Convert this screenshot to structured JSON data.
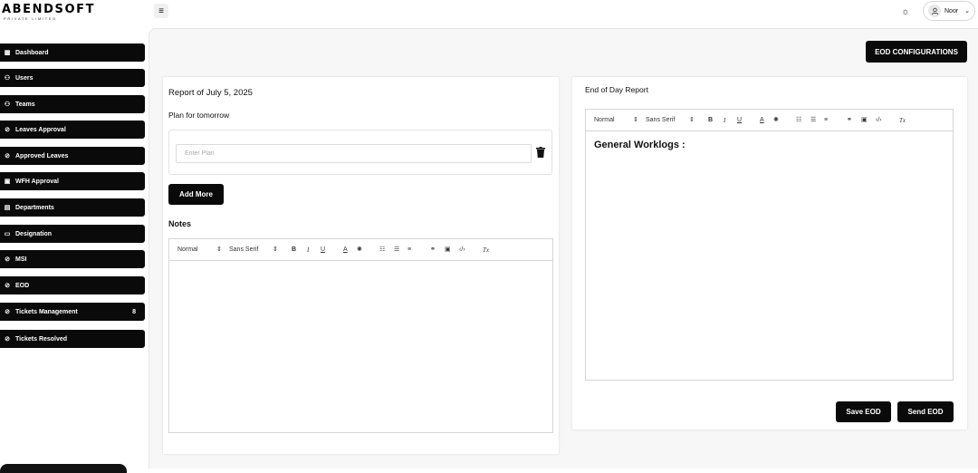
{
  "brand": {
    "name": "ABENDSOFT",
    "tagline": "PRIVATE LIMITED"
  },
  "header": {
    "menu_icon": "hamburger-icon",
    "theme_icon": "sun-icon",
    "user_name": "Noor"
  },
  "sidebar": {
    "items": [
      {
        "label": "Dashboard",
        "icon": "grid-icon"
      },
      {
        "label": "Users",
        "icon": "users-icon"
      },
      {
        "label": "Teams",
        "icon": "team-icon"
      },
      {
        "label": "Leaves Approval",
        "icon": "check-circle-icon"
      },
      {
        "label": "Approved Leaves",
        "icon": "check-circle-icon"
      },
      {
        "label": "WFH Approval",
        "icon": "doc-icon"
      },
      {
        "label": "Departments",
        "icon": "building-icon"
      },
      {
        "label": "Designation",
        "icon": "briefcase-icon"
      },
      {
        "label": "MSI",
        "icon": "check-circle-icon"
      },
      {
        "label": "EOD",
        "icon": "check-circle-icon"
      },
      {
        "label": "Tickets Management",
        "icon": "check-circle-icon",
        "badge": "8"
      },
      {
        "label": "Tickets Resolved",
        "icon": "check-circle-icon"
      }
    ]
  },
  "actions": {
    "eod_config": "EOD CONFIGURATIONS"
  },
  "report": {
    "title": "Report of July 5, 2025",
    "plan_label": "Plan for tomorrow",
    "plan_placeholder": "Enter Plan",
    "add_more": "Add More",
    "notes_label": "Notes"
  },
  "editor_toolbar": {
    "heading": "Normal",
    "font": "Sans Serif",
    "bold": "B",
    "italic": "I",
    "underline": "U",
    "color": "A",
    "clear": "Tx"
  },
  "eod": {
    "title": "End of Day Report",
    "content_heading": "General Worklogs :",
    "save": "Save EOD",
    "send": "Send EOD"
  }
}
